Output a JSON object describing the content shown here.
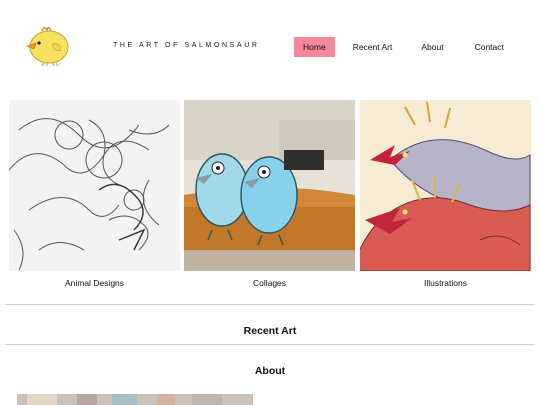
{
  "header": {
    "site_title": "THE ART OF SALMONSAUR",
    "nav": [
      {
        "label": "Home",
        "active": true
      },
      {
        "label": "Recent Art",
        "active": false
      },
      {
        "label": "About",
        "active": false
      },
      {
        "label": "Contact",
        "active": false
      }
    ]
  },
  "gallery": {
    "items": [
      {
        "caption": "Animal Designs"
      },
      {
        "caption": "Collages"
      },
      {
        "caption": "Illustrations"
      }
    ]
  },
  "sections": {
    "recent_art_title": "Recent Art",
    "about_title": "About"
  },
  "colors": {
    "nav_active_bg": "#f5889a",
    "logo_yellow": "#f6e25e",
    "divider": "#cfcfcf"
  }
}
